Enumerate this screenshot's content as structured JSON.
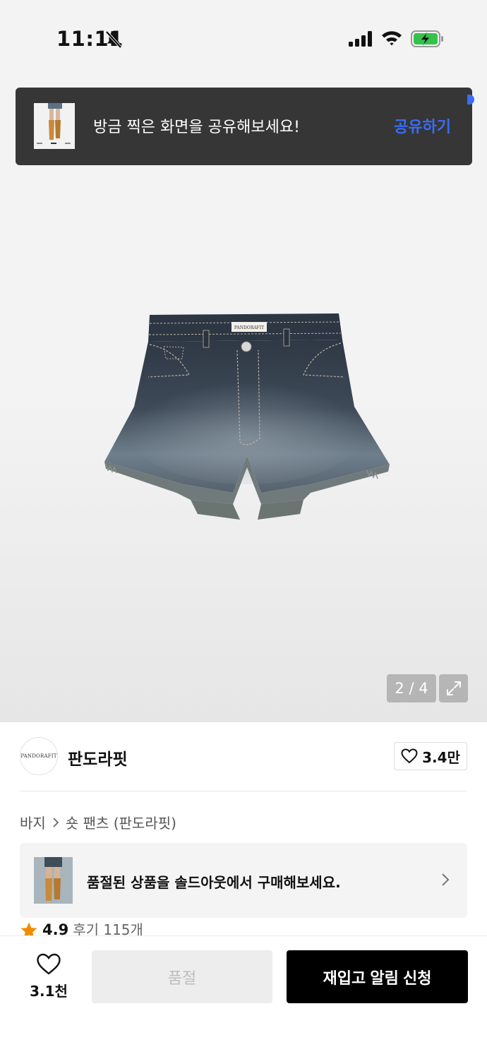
{
  "status_bar": {
    "time": "11:11"
  },
  "toast": {
    "message": "방금 찍은 화면을 공유해보세요!",
    "action_label": "공유하기"
  },
  "gallery": {
    "image_counter": "2 / 4",
    "product_label_text": "PANDORAFIT"
  },
  "brand": {
    "name": "판도라핏",
    "logo_text": "PANDORAFIT",
    "like_count": "3.4만"
  },
  "breadcrumb": {
    "category": "바지",
    "subcategory": "숏 팬츠 (판도라핏)"
  },
  "soldout_banner": {
    "text": "품절된 상품을 솔드아웃에서 구매해보세요."
  },
  "rating": {
    "score": "4.9",
    "review_label": "후기 115개"
  },
  "bottom_bar": {
    "wish_count": "3.1천",
    "soldout_label": "품절",
    "restock_label": "재입고 알림 신청"
  },
  "colors": {
    "accent": "#3a6cf4",
    "toast_bg": "#363636",
    "primary_button": "#000000",
    "disabled_button": "#ededed",
    "star": "#f28b00"
  },
  "icons": [
    "bell-slash-icon",
    "signal-icon",
    "wifi-icon",
    "battery-charging-icon",
    "expand-icon",
    "heart-icon",
    "chevron-right-icon",
    "star-icon"
  ]
}
